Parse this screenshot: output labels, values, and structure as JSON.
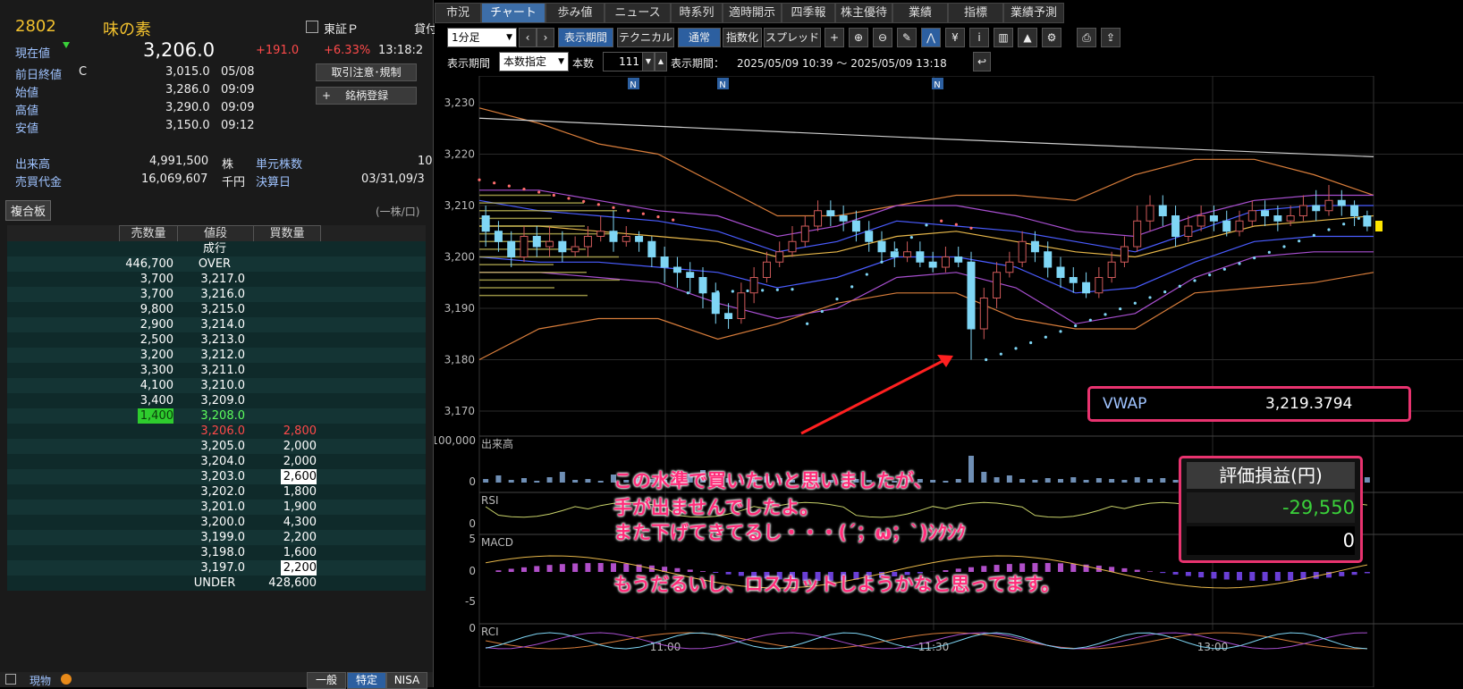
{
  "stock": {
    "code": "2802",
    "name": "味の素",
    "market": "東証Ｐ",
    "extra": "貸付",
    "current_label": "現在値",
    "current_price": "3,206.0",
    "change": "+191.0",
    "change_pct": "+6.33%",
    "time": "13:18:2",
    "prev_close_label": "前日終値",
    "prev_close_flag": "C",
    "prev_close": "3,015.0",
    "prev_close_date": "05/08",
    "open_label": "始値",
    "open": "3,286.0",
    "open_time": "09:09",
    "high_label": "高値",
    "high": "3,290.0",
    "high_time": "09:09",
    "low_label": "安値",
    "low": "3,150.0",
    "low_time": "09:12",
    "volume_label": "出来高",
    "volume": "4,991,500",
    "volume_unit": "株",
    "turnover_label": "売買代金",
    "turnover": "16,069,607",
    "turnover_unit": "千円",
    "unit_shares_label": "単元株数",
    "unit_shares": "10",
    "settle_label": "決算日",
    "settle_date": "03/31,09/3",
    "btn_restrict": "取引注意･規制",
    "btn_register": "銘柄登録",
    "btn_register_icon": "+"
  },
  "orderbook": {
    "title": "複合板",
    "unit_note": "(一株/口)",
    "headers": [
      "売数量",
      "値段",
      "買数量"
    ],
    "rows": [
      {
        "sell": "",
        "price": "成行",
        "buy": "",
        "pcolor": "#ffffff"
      },
      {
        "sell": "446,700",
        "price": "OVER",
        "buy": "",
        "pcolor": "#ffffff"
      },
      {
        "sell": "3,700",
        "price": "3,217.0",
        "buy": "",
        "pcolor": "#ffffff"
      },
      {
        "sell": "3,700",
        "price": "3,216.0",
        "buy": "",
        "pcolor": "#ffffff"
      },
      {
        "sell": "9,800",
        "price": "3,215.0",
        "buy": "",
        "pcolor": "#ffffff"
      },
      {
        "sell": "2,900",
        "price": "3,214.0",
        "buy": "",
        "pcolor": "#ffffff"
      },
      {
        "sell": "2,500",
        "price": "3,213.0",
        "buy": "",
        "pcolor": "#ffffff"
      },
      {
        "sell": "3,200",
        "price": "3,212.0",
        "buy": "",
        "pcolor": "#ffffff"
      },
      {
        "sell": "3,300",
        "price": "3,211.0",
        "buy": "",
        "pcolor": "#ffffff"
      },
      {
        "sell": "4,100",
        "price": "3,210.0",
        "buy": "",
        "pcolor": "#ffffff"
      },
      {
        "sell": "3,400",
        "price": "3,209.0",
        "buy": "",
        "pcolor": "#ffffff"
      },
      {
        "sell": "1,400",
        "price": "3,208.0",
        "buy": "",
        "pcolor": "#5dff5d",
        "sell_hl": true
      },
      {
        "sell": "",
        "price": "3,206.0",
        "buy": "2,800",
        "pcolor": "#ff4a4a",
        "bcolor": "#ff4a4a"
      },
      {
        "sell": "",
        "price": "3,205.0",
        "buy": "2,000",
        "pcolor": "#ffffff"
      },
      {
        "sell": "",
        "price": "3,204.0",
        "buy": "2,000",
        "pcolor": "#ffffff"
      },
      {
        "sell": "",
        "price": "3,203.0",
        "buy": "2,600",
        "pcolor": "#ffffff",
        "buy_hl": true
      },
      {
        "sell": "",
        "price": "3,202.0",
        "buy": "1,800",
        "pcolor": "#ffffff"
      },
      {
        "sell": "",
        "price": "3,201.0",
        "buy": "1,900",
        "pcolor": "#ffffff"
      },
      {
        "sell": "",
        "price": "3,200.0",
        "buy": "4,300",
        "pcolor": "#ffffff"
      },
      {
        "sell": "",
        "price": "3,199.0",
        "buy": "2,200",
        "pcolor": "#ffffff"
      },
      {
        "sell": "",
        "price": "3,198.0",
        "buy": "1,600",
        "pcolor": "#ffffff"
      },
      {
        "sell": "",
        "price": "3,197.0",
        "buy": "2,200",
        "pcolor": "#ffffff",
        "buy_hl": true
      },
      {
        "sell": "",
        "price": "UNDER",
        "buy": "428,600",
        "pcolor": "#ffffff"
      }
    ]
  },
  "bottom_tabs": {
    "left_label": "現物",
    "tabs": [
      "一般",
      "特定",
      "NISA"
    ],
    "active": 1
  },
  "chart_tabs": {
    "items": [
      "市況",
      "チャート",
      "歩み値",
      "ニュース",
      "時系列",
      "適時開示",
      "四季報",
      "株主優待",
      "業績",
      "指標",
      "業績予測"
    ],
    "active": 1
  },
  "toolbar": {
    "interval": "1分足",
    "btn_period": "表示期間",
    "btn_technical": "テクニカル",
    "btn_normal": "通常",
    "btn_index": "指数化",
    "btn_spread": "スプレッド",
    "icons": [
      "plus-icon",
      "zoom-in-icon",
      "zoom-out-icon",
      "pen-icon",
      "line-chart-icon",
      "yen-icon",
      "info-icon",
      "volume-bar-icon",
      "area-icon",
      "wrench-icon",
      "print-icon",
      "export-icon"
    ],
    "icon_glyphs": [
      "+",
      "⊕",
      "⊖",
      "✎",
      "⋀",
      "¥",
      "i",
      "▥",
      "▲",
      "⚙",
      "⎙",
      "⇪"
    ]
  },
  "period_bar": {
    "label": "表示期間",
    "mode": "本数指定",
    "count_label": "本数",
    "count": "111",
    "range_label": "表示期間：",
    "range": "2025/05/09 10:39 ～ 2025/05/09 13:18"
  },
  "vwap": {
    "label": "VWAP",
    "value": "3,219.3794"
  },
  "pnl": {
    "title": "評価損益(円)",
    "value": "-29,550",
    "qty": "0"
  },
  "annotations": {
    "line1": "この水準で買いたいと思いましたが、",
    "line2": "手が出ませんでしたよ。",
    "line3": "また下げてきてるし・・・(´；ω；`)ｼｸｼｸ",
    "line4": "もうだるいし、ロスカットしようかなと思ってます。"
  },
  "news_markers": [
    "N",
    "N",
    "N"
  ],
  "panel_labels": {
    "volume": "出来高",
    "rsi": "RSI",
    "macd": "MACD",
    "rci": "RCI"
  },
  "colors": {
    "up_candle": "#d05a5a",
    "down_candle": "#7fd6f5",
    "accent": "#e8336f",
    "vwap_line": "#cfcfcf"
  },
  "chart_data": {
    "type": "candlestick",
    "y_ticks": [
      "3,230",
      "3,220",
      "3,210",
      "3,200",
      "3,190",
      "3,180",
      "3,170"
    ],
    "ylim": [
      3170,
      3230
    ],
    "x_ticks": [
      "11:00",
      "11:30",
      "13:00"
    ],
    "volume_ticks": [
      "100,000",
      "0"
    ],
    "rsi_ticks": [
      "0"
    ],
    "macd_ticks": [
      "5",
      "0",
      "-5"
    ],
    "rci_ticks": [
      "0"
    ],
    "candles": [
      [
        3208,
        3205,
        3210,
        3202
      ],
      [
        3205,
        3203,
        3207,
        3201
      ],
      [
        3203,
        3200,
        3205,
        3198
      ],
      [
        3200,
        3204,
        3206,
        3199
      ],
      [
        3204,
        3202,
        3206,
        3200
      ],
      [
        3202,
        3203,
        3206,
        3200
      ],
      [
        3203,
        3201,
        3205,
        3199
      ],
      [
        3201,
        3202,
        3204,
        3200
      ],
      [
        3202,
        3204,
        3206,
        3200
      ],
      [
        3204,
        3205,
        3208,
        3203
      ],
      [
        3205,
        3203,
        3209,
        3201
      ],
      [
        3203,
        3204,
        3206,
        3202
      ],
      [
        3204,
        3203,
        3205,
        3201
      ],
      [
        3203,
        3200,
        3204,
        3198
      ],
      [
        3200,
        3198,
        3202,
        3195
      ],
      [
        3198,
        3197,
        3200,
        3194
      ],
      [
        3197,
        3196,
        3199,
        3193
      ],
      [
        3196,
        3193,
        3198,
        3190
      ],
      [
        3193,
        3189,
        3195,
        3187
      ],
      [
        3189,
        3188,
        3191,
        3186
      ],
      [
        3188,
        3193,
        3195,
        3187
      ],
      [
        3193,
        3196,
        3198,
        3191
      ],
      [
        3196,
        3199,
        3201,
        3195
      ],
      [
        3199,
        3201,
        3203,
        3198
      ],
      [
        3201,
        3203,
        3206,
        3200
      ],
      [
        3203,
        3206,
        3208,
        3202
      ],
      [
        3206,
        3209,
        3211,
        3205
      ],
      [
        3209,
        3208,
        3211,
        3206
      ],
      [
        3208,
        3207,
        3210,
        3205
      ],
      [
        3207,
        3205,
        3209,
        3203
      ],
      [
        3205,
        3203,
        3207,
        3201
      ],
      [
        3203,
        3201,
        3205,
        3199
      ],
      [
        3201,
        3200,
        3203,
        3198
      ],
      [
        3200,
        3201,
        3203,
        3199
      ],
      [
        3201,
        3199,
        3203,
        3198
      ],
      [
        3199,
        3198,
        3201,
        3197
      ],
      [
        3198,
        3200,
        3202,
        3197
      ],
      [
        3200,
        3199,
        3202,
        3198
      ],
      [
        3199,
        3186,
        3201,
        3180
      ],
      [
        3186,
        3192,
        3194,
        3184
      ],
      [
        3192,
        3197,
        3199,
        3190
      ],
      [
        3197,
        3199,
        3201,
        3196
      ],
      [
        3199,
        3203,
        3205,
        3198
      ],
      [
        3203,
        3201,
        3205,
        3199
      ],
      [
        3201,
        3198,
        3203,
        3196
      ],
      [
        3198,
        3196,
        3200,
        3194
      ],
      [
        3196,
        3195,
        3198,
        3193
      ],
      [
        3195,
        3193,
        3197,
        3192
      ],
      [
        3193,
        3196,
        3198,
        3192
      ],
      [
        3196,
        3199,
        3201,
        3195
      ],
      [
        3199,
        3202,
        3204,
        3198
      ],
      [
        3202,
        3207,
        3210,
        3201
      ],
      [
        3207,
        3210,
        3212,
        3205
      ],
      [
        3210,
        3208,
        3212,
        3206
      ],
      [
        3208,
        3204,
        3210,
        3202
      ],
      [
        3204,
        3206,
        3208,
        3203
      ],
      [
        3206,
        3208,
        3210,
        3205
      ],
      [
        3208,
        3207,
        3210,
        3205
      ],
      [
        3207,
        3205,
        3209,
        3204
      ],
      [
        3205,
        3207,
        3209,
        3204
      ],
      [
        3207,
        3209,
        3211,
        3206
      ],
      [
        3209,
        3208,
        3211,
        3206
      ],
      [
        3208,
        3207,
        3210,
        3205
      ],
      [
        3207,
        3208,
        3210,
        3206
      ],
      [
        3208,
        3210,
        3212,
        3207
      ],
      [
        3210,
        3209,
        3213,
        3207
      ],
      [
        3209,
        3211,
        3214,
        3208
      ],
      [
        3211,
        3210,
        3213,
        3208
      ],
      [
        3210,
        3208,
        3211,
        3206
      ],
      [
        3208,
        3206,
        3209,
        3205
      ]
    ]
  }
}
